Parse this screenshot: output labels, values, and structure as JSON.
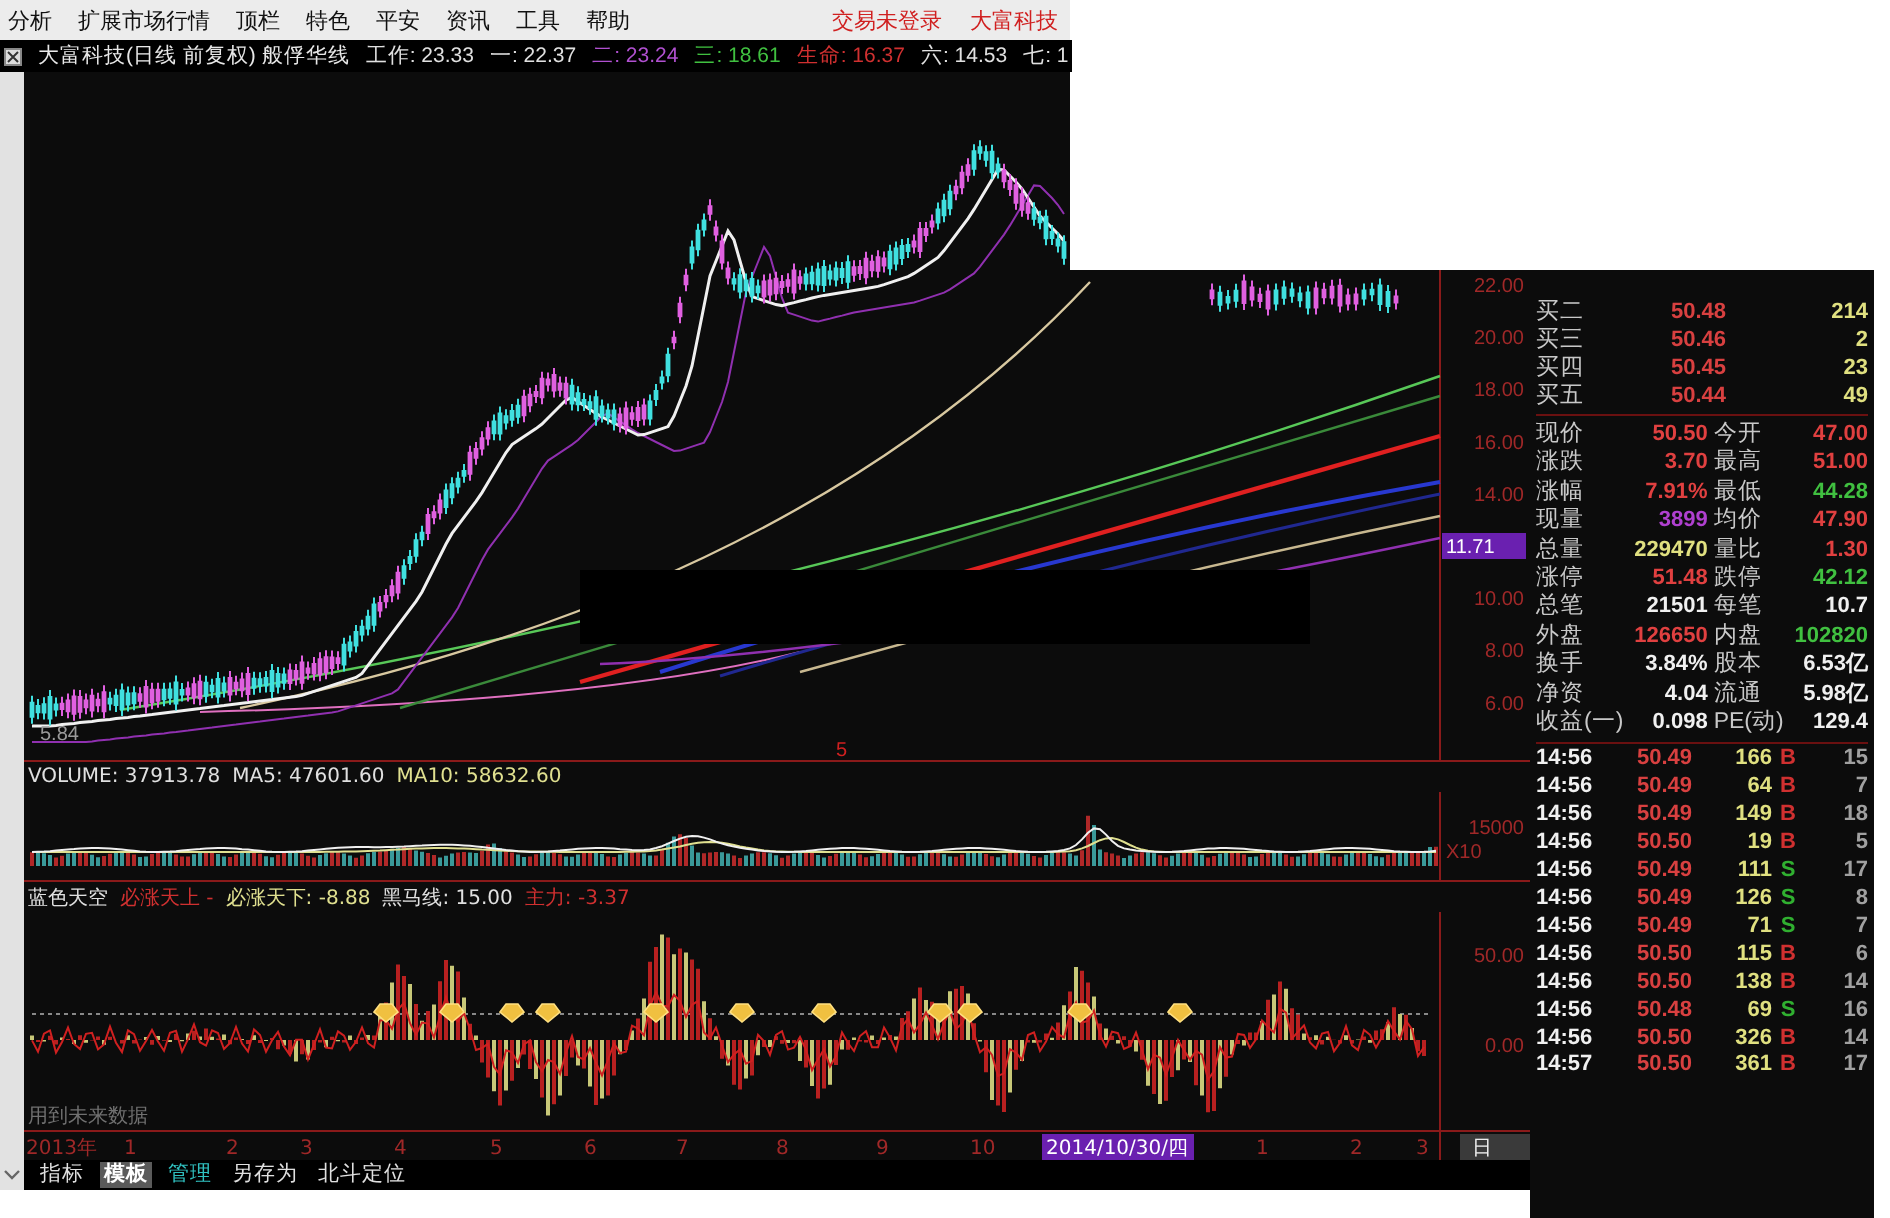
{
  "menu": [
    "分析",
    "扩展市场行情",
    "顶栏",
    "特色",
    "平安",
    "资讯",
    "工具",
    "帮助"
  ],
  "menu_links": [
    "交易未登录",
    "大富科技"
  ],
  "chart_header": {
    "title": "大富科技(日线 前复权) 般俘华线",
    "values": [
      {
        "label": "工作:",
        "value": "23.33",
        "color": "#e0e0e0"
      },
      {
        "label": "一:",
        "value": "22.37",
        "color": "#e0e0e0"
      },
      {
        "label": "二:",
        "value": "23.24",
        "color": "#b050d0"
      },
      {
        "label": "三:",
        "value": "18.61",
        "color": "#40c040"
      },
      {
        "label": "生命:",
        "value": "16.37",
        "color": "#d03030"
      },
      {
        "label": "六:",
        "value": "14.53",
        "color": "#e0e0e0"
      },
      {
        "label": "七:",
        "value": "1",
        "color": "#e0e0e0"
      }
    ]
  },
  "price_axis": [
    {
      "label": "22.00",
      "selected": false
    },
    {
      "label": "20.00",
      "selected": false
    },
    {
      "label": "18.00",
      "selected": false
    },
    {
      "label": "16.00",
      "selected": false
    },
    {
      "label": "14.00",
      "selected": false
    },
    {
      "label": "11.71",
      "selected": true
    },
    {
      "label": "10.00",
      "selected": false
    },
    {
      "label": "8.00",
      "selected": false
    },
    {
      "label": "6.00",
      "selected": false
    }
  ],
  "low_marker": "5.84",
  "bar_marker": "5",
  "volume": {
    "values": [
      {
        "label": "VOLUME:",
        "value": "37913.78",
        "color": "#e0e0e0"
      },
      {
        "label": "MA5:",
        "value": "47601.60",
        "color": "#e0e0e0"
      },
      {
        "label": "MA10:",
        "value": "58632.60",
        "color": "#e0e090"
      }
    ],
    "axis": [
      "15000",
      "X10"
    ]
  },
  "indicator": {
    "name": "蓝色天空",
    "values": [
      {
        "label": "必涨天上",
        "value": "-",
        "color": "#d03030"
      },
      {
        "label": "必涨天下:",
        "value": "-8.88",
        "color": "#e0e090"
      },
      {
        "label": "黑马线:",
        "value": "15.00",
        "color": "#e0e0e0"
      },
      {
        "label": "主力:",
        "value": "-3.37",
        "color": "#d03030"
      }
    ],
    "axis": [
      "50.00",
      "0.00"
    ],
    "note": "用到未来数据"
  },
  "date_axis": [
    {
      "label": "2013年",
      "selected": false
    },
    {
      "label": "1",
      "selected": false
    },
    {
      "label": "2",
      "selected": false
    },
    {
      "label": "3",
      "selected": false
    },
    {
      "label": "4",
      "selected": false
    },
    {
      "label": "5",
      "selected": false
    },
    {
      "label": "6",
      "selected": false
    },
    {
      "label": "7",
      "selected": false
    },
    {
      "label": "8",
      "selected": false
    },
    {
      "label": "9",
      "selected": false
    },
    {
      "label": "10",
      "selected": false
    },
    {
      "label": "2014/10/30/四",
      "selected": true
    },
    {
      "label": "1",
      "selected": false
    },
    {
      "label": "2",
      "selected": false
    },
    {
      "label": "3",
      "selected": false
    }
  ],
  "period": "日",
  "tabs": [
    {
      "label": "指标",
      "selected": false,
      "color": "#e0e0e0"
    },
    {
      "label": "模板",
      "selected": true,
      "color": "#ffffff"
    },
    {
      "label": "管理",
      "selected": false,
      "color": "#30c0c0"
    },
    {
      "label": "另存为",
      "selected": false,
      "color": "#e0e0e0"
    },
    {
      "label": "北斗定位",
      "selected": false,
      "color": "#e0e0e0"
    }
  ],
  "quote": {
    "bids": [
      {
        "label": "买二",
        "price": "50.48",
        "volume": "214"
      },
      {
        "label": "买三",
        "price": "50.46",
        "volume": "2"
      },
      {
        "label": "买四",
        "price": "50.45",
        "volume": "23"
      },
      {
        "label": "买五",
        "price": "50.44",
        "volume": "49"
      }
    ],
    "stats": [
      {
        "label": "现价",
        "value": "50.50",
        "color": "#e04040"
      },
      {
        "label": "今开",
        "value": "47.00",
        "color": "#e04040"
      },
      {
        "label": "涨跌",
        "value": "3.70",
        "color": "#e04040"
      },
      {
        "label": "最高",
        "value": "51.00",
        "color": "#e04040"
      },
      {
        "label": "涨幅",
        "value": "7.91%",
        "color": "#e04040"
      },
      {
        "label": "最低",
        "value": "44.28",
        "color": "#40c040"
      },
      {
        "label": "现量",
        "value": "3899",
        "color": "#b040d0"
      },
      {
        "label": "均价",
        "value": "47.90",
        "color": "#e04040"
      },
      {
        "label": "总量",
        "value": "229470",
        "color": "#e0e080"
      },
      {
        "label": "量比",
        "value": "1.30",
        "color": "#e04040"
      },
      {
        "label": "涨停",
        "value": "51.48",
        "color": "#e04040"
      },
      {
        "label": "跌停",
        "value": "42.12",
        "color": "#40c040"
      },
      {
        "label": "总笔",
        "value": "21501",
        "color": "#f0f0f0"
      },
      {
        "label": "每笔",
        "value": "10.7",
        "color": "#f0f0f0"
      },
      {
        "label": "外盘",
        "value": "126650",
        "color": "#e04040"
      },
      {
        "label": "内盘",
        "value": "102820",
        "color": "#40c040"
      },
      {
        "label": "换手",
        "value": "3.84%",
        "color": "#f0f0f0"
      },
      {
        "label": "股本",
        "value": "6.53亿",
        "color": "#f0f0f0"
      },
      {
        "label": "净资",
        "value": "4.04",
        "color": "#f0f0f0"
      },
      {
        "label": "流通",
        "value": "5.98亿",
        "color": "#f0f0f0"
      },
      {
        "label": "收益(一)",
        "value": "0.098",
        "color": "#f0f0f0"
      },
      {
        "label": "PE(动)",
        "value": "129.4",
        "color": "#f0f0f0"
      }
    ],
    "trades": [
      {
        "time": "14:56",
        "price": "50.49",
        "volume": "166",
        "side": "B",
        "color": "#d03030",
        "count": "15"
      },
      {
        "time": "14:56",
        "price": "50.49",
        "volume": "64",
        "side": "B",
        "color": "#d03030",
        "count": "7"
      },
      {
        "time": "14:56",
        "price": "50.49",
        "volume": "149",
        "side": "B",
        "color": "#d03030",
        "count": "18"
      },
      {
        "time": "14:56",
        "price": "50.50",
        "volume": "19",
        "side": "B",
        "color": "#d03030",
        "count": "5"
      },
      {
        "time": "14:56",
        "price": "50.49",
        "volume": "111",
        "side": "S",
        "color": "#30b030",
        "count": "17"
      },
      {
        "time": "14:56",
        "price": "50.49",
        "volume": "126",
        "side": "S",
        "color": "#30b030",
        "count": "8"
      },
      {
        "time": "14:56",
        "price": "50.49",
        "volume": "71",
        "side": "S",
        "color": "#30b030",
        "count": "7"
      },
      {
        "time": "14:56",
        "price": "50.50",
        "volume": "115",
        "side": "B",
        "color": "#d03030",
        "count": "6"
      },
      {
        "time": "14:56",
        "price": "50.50",
        "volume": "138",
        "side": "B",
        "color": "#d03030",
        "count": "14"
      },
      {
        "time": "14:56",
        "price": "50.48",
        "volume": "69",
        "side": "S",
        "color": "#30b030",
        "count": "16"
      },
      {
        "time": "14:56",
        "price": "50.50",
        "volume": "326",
        "side": "B",
        "color": "#d03030",
        "count": "14"
      },
      {
        "time": "14:57",
        "price": "50.50",
        "volume": "361",
        "side": "B",
        "color": "#d03030",
        "count": "17"
      }
    ]
  }
}
